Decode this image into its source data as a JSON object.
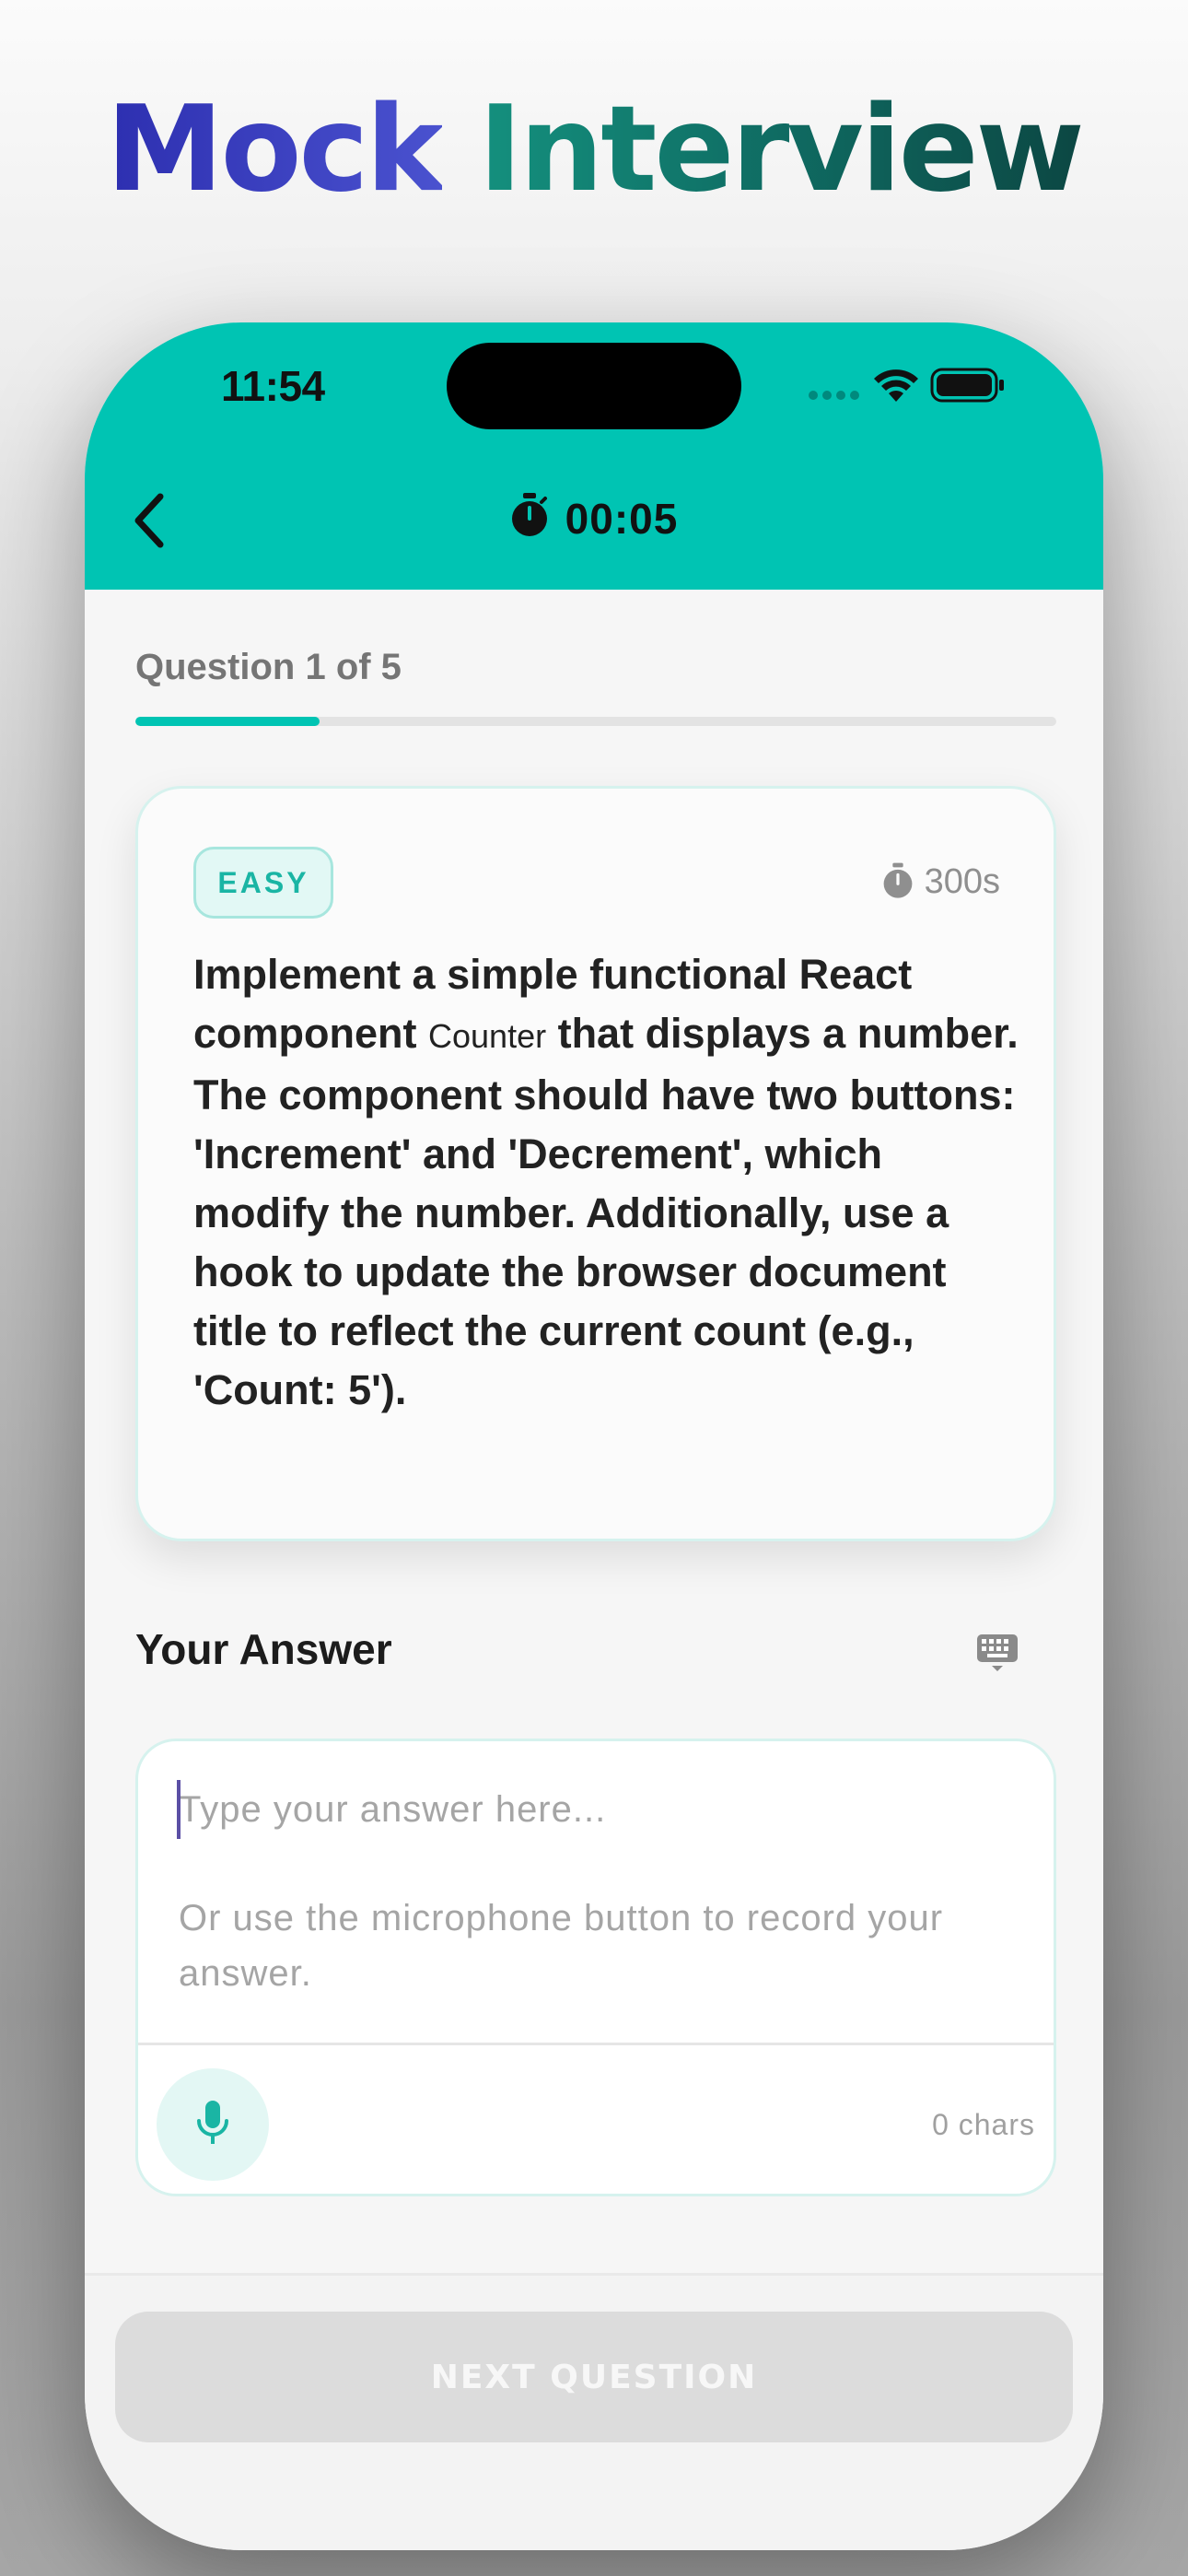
{
  "promo": {
    "word1": "Mock",
    "word2": "Interview"
  },
  "status_bar": {
    "time": "11:54"
  },
  "header": {
    "timer": "00:05"
  },
  "progress": {
    "label": "Question 1 of 5",
    "current": 1,
    "total": 5,
    "fraction": 0.2
  },
  "question": {
    "difficulty": "EASY",
    "time_limit": "300s",
    "text_before": "Implement a simple functional React component ",
    "code": "Counter",
    "text_after": " that displays a number. The component should have two buttons: 'Increment' and 'Decrement', which modify the number. Additionally, use a hook to update the browser document title to reflect the current count (e.g., 'Count: 5')."
  },
  "answer": {
    "title": "Your Answer",
    "value": "",
    "placeholder": "Type your answer here...",
    "hint": "Or use the microphone button to record your answer.",
    "char_count": "0 chars"
  },
  "footer": {
    "next_label": "NEXT QUESTION"
  },
  "icons": {
    "back": "chevron-left-icon",
    "timer": "stopwatch-icon",
    "keyboard": "keyboard-icon",
    "mic": "microphone-icon",
    "wifi": "wifi-icon",
    "battery": "battery-icon",
    "signal": "cellular-signal-icon"
  },
  "colors": {
    "accent": "#00c4b3",
    "badge_text": "#1ab5a4",
    "disabled_button": "#dcdcdc"
  }
}
